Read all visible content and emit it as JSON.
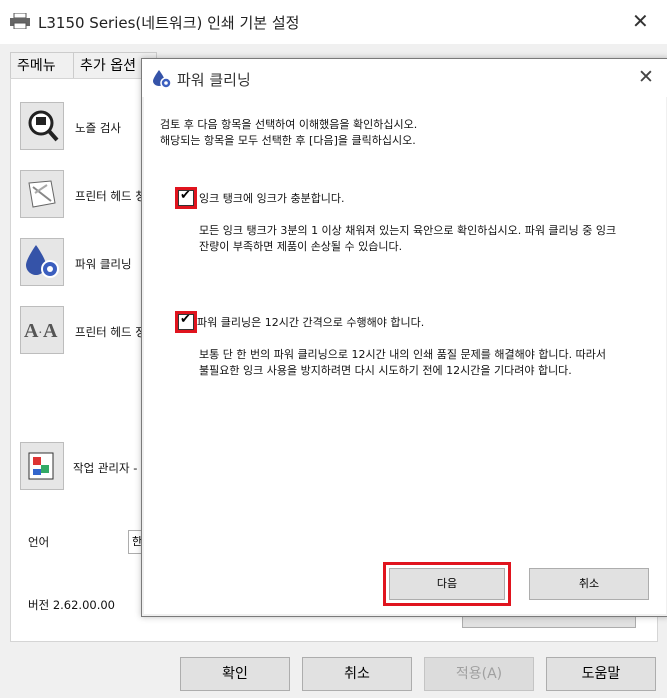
{
  "window": {
    "title": "L3150 Series(네트워크) 인쇄 기본 설정",
    "close_glyph": "✕",
    "tabs": [
      "주메뉴",
      "추가 옵션"
    ]
  },
  "utilities": [
    {
      "label": "노즐 검사",
      "icon": "nozzle-check-icon"
    },
    {
      "label": "프린터 헤드 청",
      "icon": "head-cleaning-icon"
    },
    {
      "label": "파워 클리닝",
      "icon": "power-cleaning-icon"
    },
    {
      "label": "프린터 헤드 정",
      "icon": "head-alignment-icon"
    },
    {
      "label": "작업 관리자 -",
      "icon": "job-manager-icon"
    }
  ],
  "language": {
    "label": "언어",
    "value": "한"
  },
  "version": {
    "label": "버전 2.62.00.00"
  },
  "bottom_buttons": {
    "ok": "확인",
    "cancel": "취소",
    "apply": "적용(A)",
    "help": "도움말"
  },
  "dialog": {
    "title": "파워 클리닝",
    "intro": [
      "검토 후 다음 항목을 선택하여 이해했음을 확인하십시오.",
      "해당되는 항목을 모두 선택한 후 [다음]을 클릭하십시오."
    ],
    "items": [
      {
        "checked": true,
        "label": "잉크 탱크에 잉크가 충분합니다.",
        "desc": [
          "모든 잉크 탱크가 3분의 1 이상 채워져 있는지 육안으로 확인하십시오. 파워 클리닝 중 잉크",
          "잔량이 부족하면 제품이 손상될 수 있습니다."
        ]
      },
      {
        "checked": true,
        "label": "파워 클리닝은 12시간 간격으로 수행해야 합니다.",
        "desc": [
          "보통 단 한 번의 파워 클리닝으로 12시간 내의 인쇄 품질 문제를 해결해야 합니다. 따라서",
          "불필요한 잉크 사용을 방지하려면 다시 시도하기 전에 12시간을 기다려야 합니다."
        ]
      }
    ],
    "next_label": "다음",
    "cancel_label": "취소",
    "check_glyph": "✔"
  },
  "colors": {
    "highlight": "#e0141e"
  }
}
